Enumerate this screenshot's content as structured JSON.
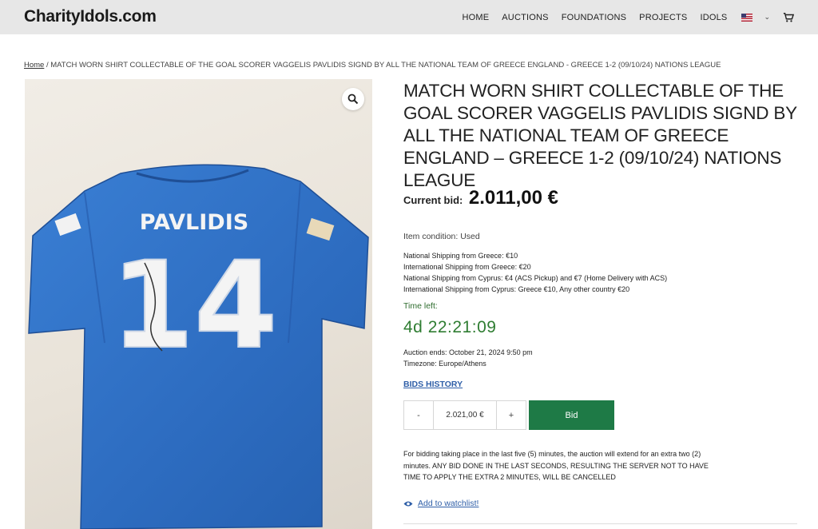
{
  "header": {
    "logo": "CharityIdols.com",
    "nav": [
      "HOME",
      "AUCTIONS",
      "FOUNDATIONS",
      "PROJECTS",
      "IDOLS"
    ],
    "language_icon": "us-flag-icon",
    "cart_icon": "cart-icon"
  },
  "breadcrumb": {
    "home": "Home",
    "current": " / MATCH WORN SHIRT COLLECTABLE OF THE GOAL SCORER VAGGELIS PAVLIDIS SIGND BY ALL THE NATIONAL TEAM OF GREECE ENGLAND - GREECE 1-2 (09/10/24) NATIONS LEAGUE"
  },
  "product": {
    "title": "MATCH WORN SHIRT COLLECTABLE OF THE GOAL SCORER VAGGELIS PAVLIDIS SIGND BY ALL THE NATIONAL TEAM OF GREECE ENGLAND – GREECE 1-2 (09/10/24) NATIONS LEAGUE",
    "image": {
      "shirt_name": "PAVLIDIS",
      "shirt_number": "14",
      "shirt_color": "#2f6fc4"
    },
    "current_bid_label": "Current bid:",
    "current_bid_value": "2.011,00 €",
    "condition": "Item condition: Used",
    "shipping": [
      "National Shipping from Greece: €10",
      "International Shipping from Greece: €20",
      "National Shipping from Cyprus: €4 (ACS Pickup) and €7 (Home Delivery with ACS)",
      "International Shipping from Cyprus: Greece €10, Any other country €20"
    ],
    "time_left_label": "Time left:",
    "time_left": "4d 22:21:09",
    "auction_ends": "Auction ends: October 21, 2024 9:50 pm",
    "timezone": "Timezone: Europe/Athens",
    "bids_history": "BIDS HISTORY",
    "bid_input_value": "2.021,00 €",
    "minus_label": "-",
    "plus_label": "+",
    "bid_button": "Bid",
    "notice": "For bidding taking place in the last five (5) minutes, the auction will extend for an extra two (2) minutes. ANY BID DONE IN THE LAST SECONDS, RESULTING THE SERVER NOT TO HAVE TIME TO APPLY THE EXTRA 2 MINUTES, WILL BE CANCELLED",
    "watchlist": "Add to watchlist!"
  },
  "colors": {
    "bid_button": "#1e7a46",
    "time_left": "#2f7d32",
    "link": "#2f5fa8",
    "topbar": "#e7e7e7"
  }
}
